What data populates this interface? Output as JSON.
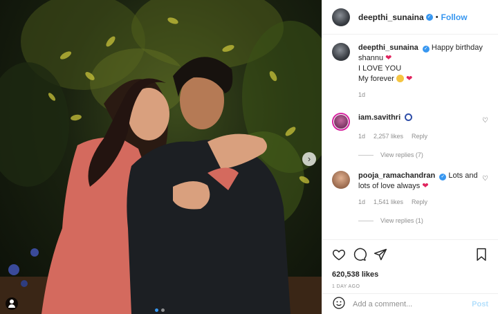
{
  "post": {
    "username": "deepthi_sunaina",
    "follow_label": "Follow",
    "caption": {
      "line1": "Happy birthday",
      "line2": "shannu",
      "line3": "I LOVE YOU",
      "line4": "My forever",
      "time": "1d"
    },
    "comments": [
      {
        "username": "iam.savithri",
        "text": "",
        "time": "1d",
        "likes": "2,257 likes",
        "reply_label": "Reply",
        "view_replies": "View replies (7)"
      },
      {
        "username": "pooja_ramachandran",
        "text": "Lots and lots of love always",
        "time": "1d",
        "likes": "1,541 likes",
        "reply_label": "Reply",
        "view_replies": "View replies (1)"
      }
    ],
    "likes_count": "620,538 likes",
    "posted_ago": "1 DAY AGO",
    "add_comment_placeholder": "Add a comment...",
    "post_label": "Post"
  },
  "colors": {
    "accent": "#3897f0",
    "heart": "#e0245e",
    "muted": "#8e8e8e"
  },
  "icons": [
    "next-arrow-icon",
    "user-tag-icon",
    "verified-icon",
    "heart-icon",
    "comment-icon",
    "share-icon",
    "bookmark-icon",
    "emoji-icon"
  ]
}
